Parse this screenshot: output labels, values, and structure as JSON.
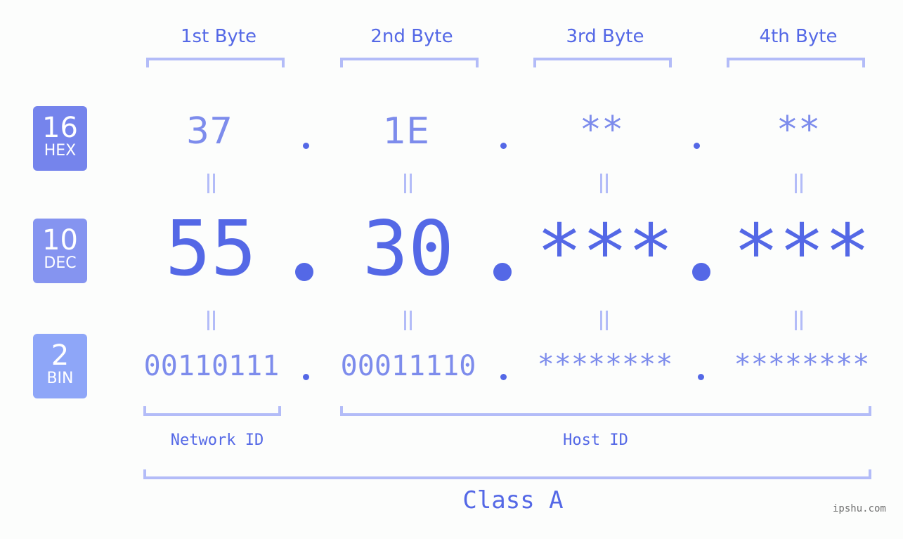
{
  "byte_headers": [
    "1st Byte",
    "2nd Byte",
    "3rd Byte",
    "4th Byte"
  ],
  "badges": {
    "hex": {
      "base": "16",
      "name": "HEX",
      "color": "#7584ec"
    },
    "dec": {
      "base": "10",
      "name": "DEC",
      "color": "#8594f0"
    },
    "bin": {
      "base": "2",
      "name": "BIN",
      "color": "#8ea6f8"
    }
  },
  "hex": [
    "37",
    "1E",
    "**",
    "**"
  ],
  "dec": [
    "55",
    "30",
    "***",
    "***"
  ],
  "bin": [
    "00110111",
    "00011110",
    "********",
    "********"
  ],
  "separator": ".",
  "network_label": "Network ID",
  "host_label": "Host ID",
  "class_label": "Class A",
  "watermark": "ipshu.com",
  "colors": {
    "accent": "#5468e6",
    "secondary": "#7d8cec",
    "bracket": "#b3bcf8",
    "background": "#fcfdfc"
  }
}
